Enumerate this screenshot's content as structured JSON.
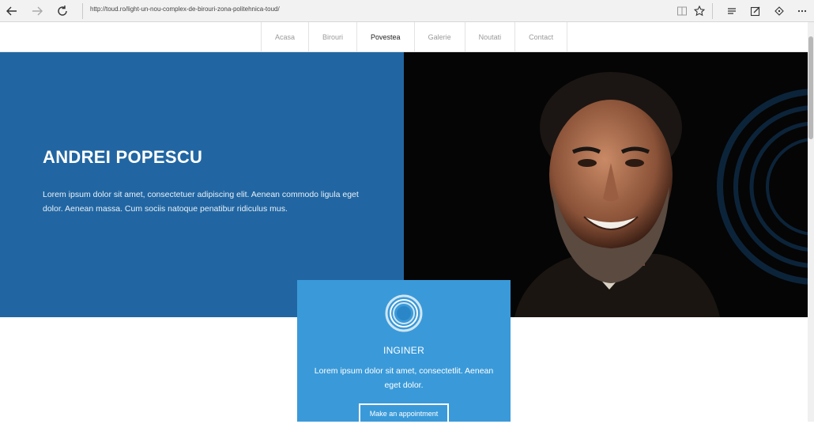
{
  "browser": {
    "url": "http://toud.ro/light-un-nou-complex-de-birouri-zona-politehnica-toud/",
    "icons": [
      "back-icon",
      "forward-icon",
      "refresh-icon",
      "reading-view-icon",
      "favorite-star-icon",
      "hub-icon",
      "web-note-icon",
      "share-icon",
      "more-icon"
    ]
  },
  "nav": {
    "items": [
      "Acasa",
      "Birouri",
      "Povestea",
      "Galerie",
      "Noutati",
      "Contact"
    ],
    "active": "Povestea"
  },
  "hero": {
    "name": "ANDREI POPESCU",
    "text": "Lorem ipsum dolor sit amet, consectetuer adipiscing elit. Aenean commodo ligula eget dolor. Aenean massa. Cum sociis natoque penatibur ridiculus mus.",
    "bg_color": "#2166a2"
  },
  "card": {
    "icon": "rings-icon",
    "title": "INGINER",
    "text": "Lorem ipsum dolor sit amet, consectetlit. Aenean eget dolor.",
    "button": "Make an appointment",
    "bg_color": "#3a9ad9"
  }
}
